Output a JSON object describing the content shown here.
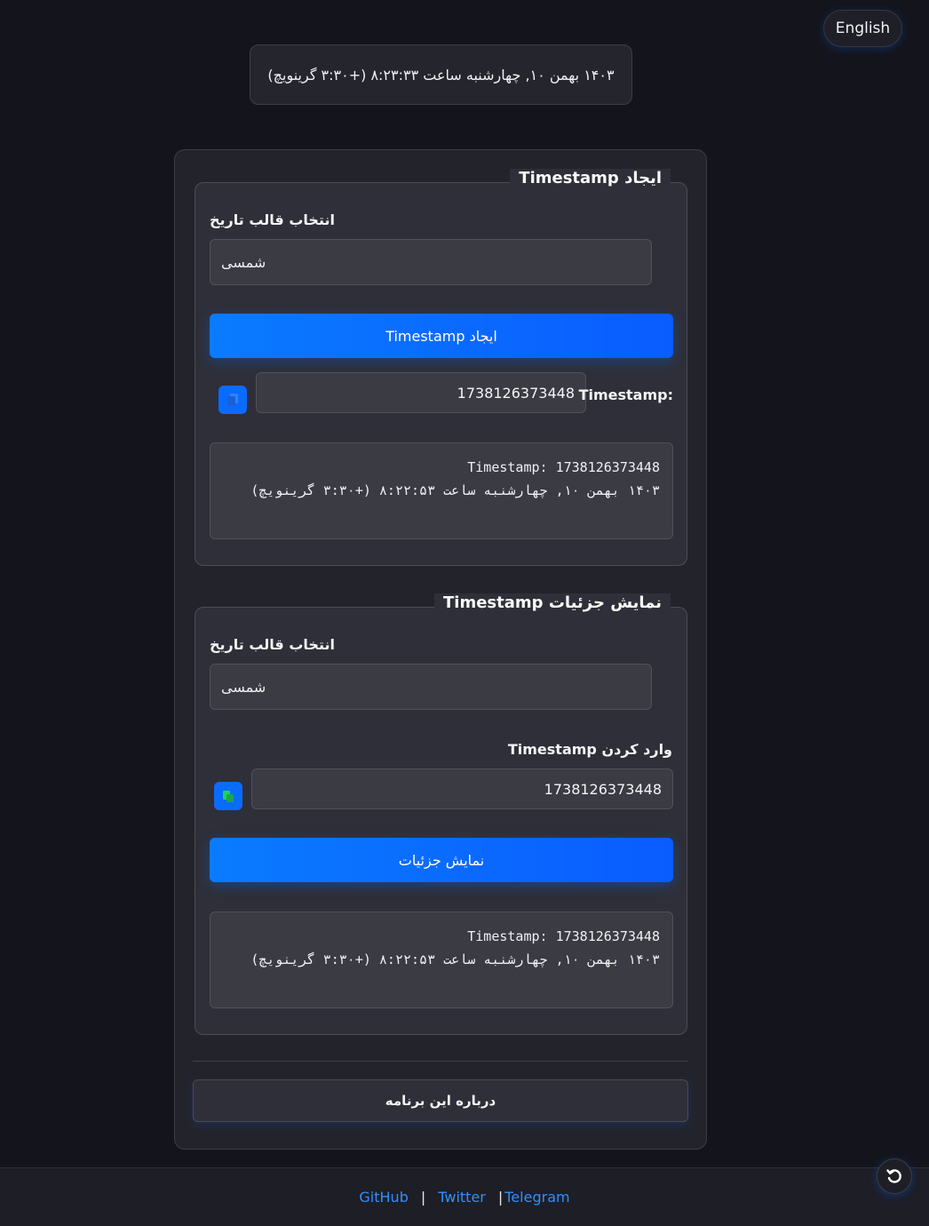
{
  "header": {
    "language_button": "English",
    "current_datetime": "۱۴۰۳ بهمن ۱۰, چهارشنبه ساعت ۸:۲۳:۳۳ (+۳:۳۰ گرینویچ)"
  },
  "create_section": {
    "legend": "ایجاد Timestamp",
    "format_label": "انتخاب قالب تاریخ",
    "format_value": "شمسی",
    "create_button": "ایجاد Timestamp",
    "timestamp_label": "Timestamp:",
    "timestamp_value": "1738126373448",
    "output_text": "Timestamp: 1738126373448\n۱۴۰۳ بهمن ۱۰, چهارشنبه ساعت ۸:۲۲:۵۳ (+۳:۳۰ گرینویچ)"
  },
  "details_section": {
    "legend": "نمایش جزئیات Timestamp",
    "format_label": "انتخاب قالب تاریخ",
    "format_value": "شمسی",
    "input_label": "وارد کردن Timestamp",
    "input_value": "1738126373448",
    "show_button": "نمایش جزئیات",
    "output_text": "Timestamp: 1738126373448\n۱۴۰۳ بهمن ۱۰, چهارشنبه ساعت ۸:۲۲:۵۳ (+۳:۳۰ گرینویچ)"
  },
  "about_button": "درباره این برنامه",
  "footer": {
    "links": [
      "GitHub",
      "Twitter",
      "Telegram"
    ],
    "separator": "|"
  },
  "icons": {
    "copy": "copy-icon",
    "paste": "paste-icon",
    "reset": "reset-icon"
  },
  "colors": {
    "accent": "#0a6cff",
    "link": "#2f8fff",
    "background": "#14151c"
  }
}
